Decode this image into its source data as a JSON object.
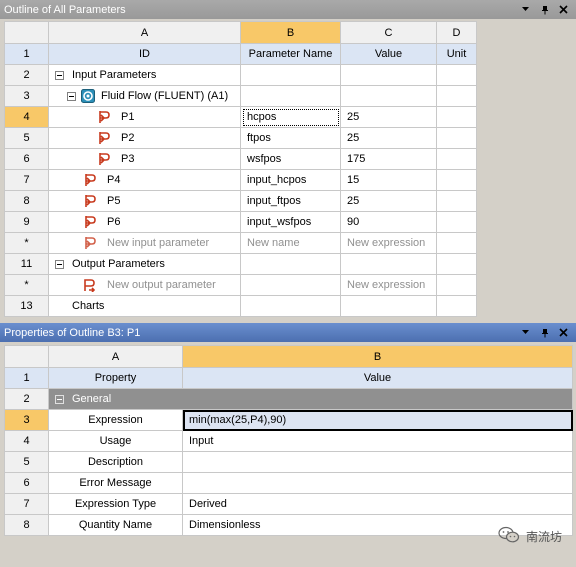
{
  "top_panel": {
    "title": "Outline of All Parameters",
    "column_letters": [
      "A",
      "B",
      "C",
      "D"
    ],
    "field_headers": {
      "row": "1",
      "id": "ID",
      "name": "Parameter Name",
      "value": "Value",
      "unit": "Unit"
    },
    "rows": [
      {
        "rn": "2",
        "label": "Input Parameters",
        "name": "",
        "value": ""
      },
      {
        "rn": "3",
        "label": "Fluid Flow (FLUENT) (A1)",
        "name": "",
        "value": ""
      },
      {
        "rn": "4",
        "label": "P1",
        "name": "hcpos",
        "value": "25"
      },
      {
        "rn": "5",
        "label": "P2",
        "name": "ftpos",
        "value": "25"
      },
      {
        "rn": "6",
        "label": "P3",
        "name": "wsfpos",
        "value": "175"
      },
      {
        "rn": "7",
        "label": "P4",
        "name": "input_hcpos",
        "value": "15"
      },
      {
        "rn": "8",
        "label": "P5",
        "name": "input_ftpos",
        "value": "25"
      },
      {
        "rn": "9",
        "label": "P6",
        "name": "input_wsfpos",
        "value": "90"
      },
      {
        "rn": "*",
        "label": "New input parameter",
        "name": "New name",
        "value": "New expression"
      },
      {
        "rn": "11",
        "label": "Output Parameters",
        "name": "",
        "value": ""
      },
      {
        "rn": "*",
        "label": "New output parameter",
        "name": "",
        "value": "New expression"
      },
      {
        "rn": "13",
        "label": "Charts",
        "name": "",
        "value": ""
      }
    ]
  },
  "bottom_panel": {
    "title": "Properties of Outline B3: P1",
    "column_letters": [
      "A",
      "B"
    ],
    "field_headers": {
      "row": "1",
      "property": "Property",
      "value": "Value"
    },
    "group": {
      "rn": "2",
      "label": "General"
    },
    "rows": [
      {
        "rn": "3",
        "property": "Expression",
        "value": "min(max(25,P4),90)"
      },
      {
        "rn": "4",
        "property": "Usage",
        "value": "Input"
      },
      {
        "rn": "5",
        "property": "Description",
        "value": ""
      },
      {
        "rn": "6",
        "property": "Error Message",
        "value": ""
      },
      {
        "rn": "7",
        "property": "Expression Type",
        "value": "Derived"
      },
      {
        "rn": "8",
        "property": "Quantity Name",
        "value": "Dimensionless"
      }
    ]
  },
  "icons": {
    "dropdown": "dropdown-arrow-icon",
    "pin": "pin-icon",
    "close": "close-icon",
    "parameter": "parameter-icon",
    "output_parameter": "output-parameter-icon",
    "system": "fluent-system-icon",
    "expand": "collapse-toggle-icon"
  },
  "colors": {
    "selected_header": "#f8c868",
    "field_header": "#dbe5f4",
    "group_row": "#909090",
    "active_title": "#4c6fb0",
    "inactive_title": "#999999"
  },
  "watermark": {
    "text": "南流坊"
  }
}
